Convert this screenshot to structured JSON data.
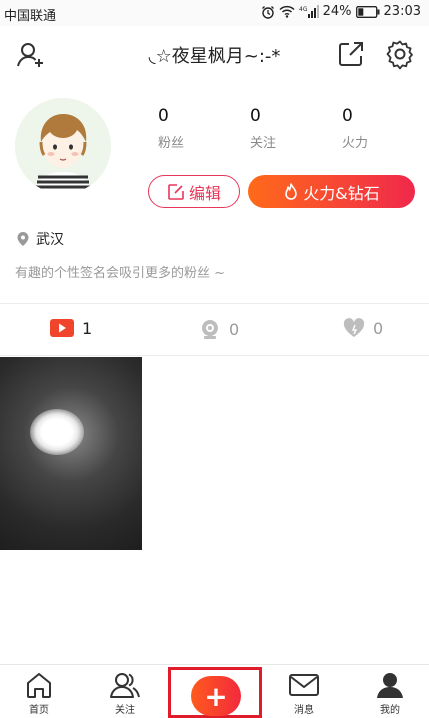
{
  "status_bar": {
    "carrier": "中国联通",
    "signal_label": "4G",
    "battery": "24%",
    "time": "23:03"
  },
  "header": {
    "title": "◟☆夜星枫月~:-*"
  },
  "profile": {
    "stats": [
      {
        "value": "0",
        "label": "粉丝"
      },
      {
        "value": "0",
        "label": "关注"
      },
      {
        "value": "0",
        "label": "火力"
      }
    ],
    "edit_label": "编辑",
    "fire_label": "火力&钻石",
    "location": "武汉",
    "signature": "有趣的个性签名会吸引更多的粉丝 ~"
  },
  "tabs": [
    {
      "icon": "video-icon",
      "count": "1"
    },
    {
      "icon": "camera-icon",
      "count": "0"
    },
    {
      "icon": "heart-icon",
      "count": "0"
    }
  ],
  "bottom_nav": {
    "items": [
      {
        "icon": "home-icon",
        "label": "首页"
      },
      {
        "icon": "follow-icon",
        "label": "关注"
      },
      {
        "icon": "message-icon",
        "label": "消息"
      },
      {
        "icon": "me-icon",
        "label": "我的"
      }
    ],
    "post_symbol": "+"
  },
  "colors": {
    "accent": "#e8365a",
    "gradient_start": "#ff6a1a",
    "gradient_end": "#f0284c",
    "highlight": "#e01b2a"
  }
}
